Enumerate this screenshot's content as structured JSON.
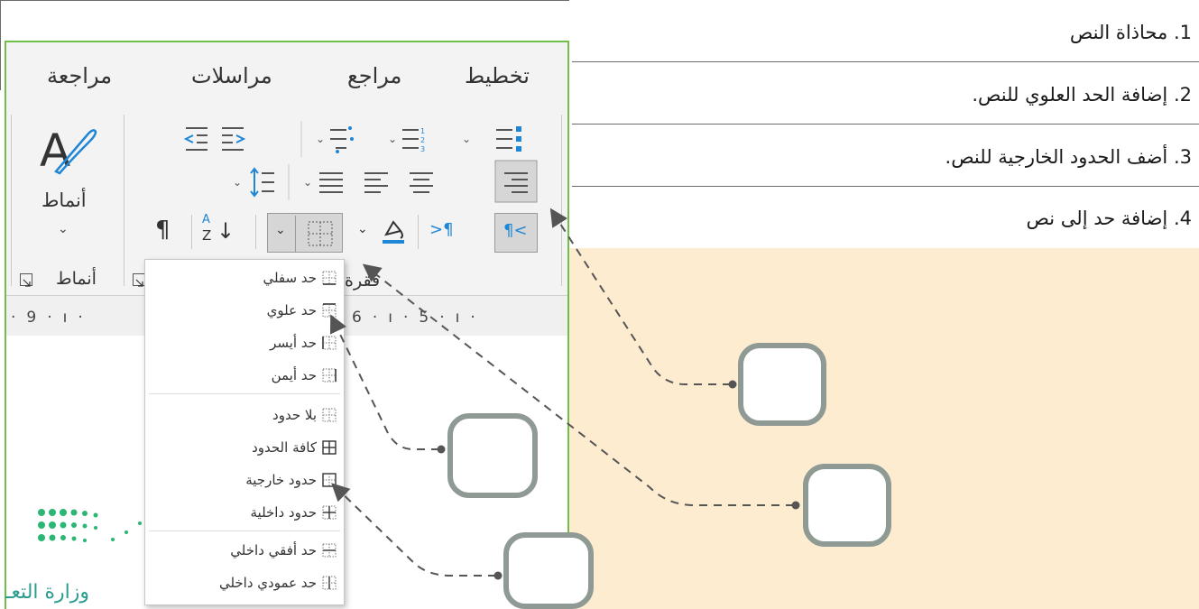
{
  "instructions": [
    {
      "number": "1.",
      "text": "محاذاة النص"
    },
    {
      "number": "2.",
      "text": "إضافة الحد العلوي للنص."
    },
    {
      "number": "3.",
      "text": "أضف الحدود الخارجية للنص."
    },
    {
      "number": "4.",
      "text": "إضافة حد إلى نص"
    }
  ],
  "ribbon": {
    "tabs": [
      "تخطيط",
      "مراجع",
      "مراسلات",
      "مراجعة"
    ],
    "styles_button_label": "أنماط",
    "paragraph_group_label": "فقرة",
    "styles_group_label": "أنماط",
    "sort_glyph_a": "A",
    "sort_glyph_z": "Z",
    "pilcrow": "¶",
    "ltr_label": ">¶",
    "rtl_label": "¶<"
  },
  "ruler": {
    "left_nums": [
      "9",
      "ı"
    ],
    "right_nums": [
      "6",
      "ı",
      "5",
      "ı"
    ]
  },
  "border_menu": {
    "items": [
      "حد سفلي",
      "حد علوي",
      "حد أيسر",
      "حد أيمن",
      "بلا حدود",
      "كافة الحدود",
      "حدود خارجية",
      "حدود داخلية",
      "حد أفقي داخلي",
      "حد عمودي داخلي"
    ]
  },
  "logo": {
    "text": "وزارة التعـ"
  },
  "colors": {
    "accent_green": "#6fbf4a",
    "callout_border": "#8f9a95",
    "peach_bg": "#fdecd0",
    "word_blue": "#1f86d6"
  }
}
